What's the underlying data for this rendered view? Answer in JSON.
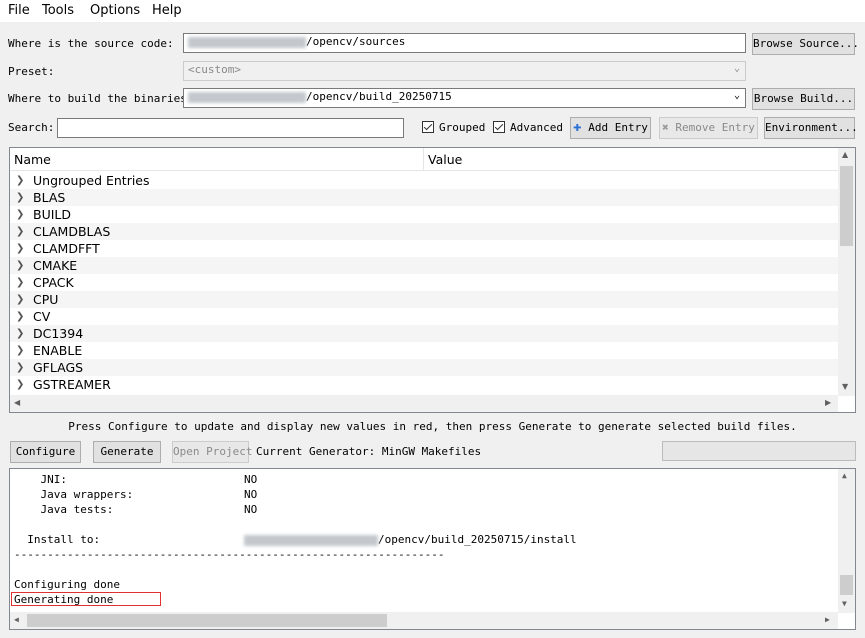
{
  "menu": [
    "File",
    "Tools",
    "Options",
    "Help"
  ],
  "source": {
    "label": "Where is the source code:",
    "value_suffix": "/opencv/sources",
    "browse_label": "Browse Source..."
  },
  "preset": {
    "label": "Preset:",
    "value": "<custom>"
  },
  "binaries": {
    "label": "Where to build the binaries:",
    "value_suffix": "/opencv/build_20250715",
    "browse_label": "Browse Build..."
  },
  "search": {
    "label": "Search:",
    "value": ""
  },
  "options": {
    "grouped_label": "Grouped",
    "grouped_checked": true,
    "advanced_label": "Advanced",
    "advanced_checked": true,
    "add_entry_label": "Add Entry",
    "remove_entry_label": "Remove Entry",
    "environment_label": "Environment..."
  },
  "table": {
    "col_name": "Name",
    "col_value": "Value",
    "rows": [
      "Ungrouped Entries",
      "BLAS",
      "BUILD",
      "CLAMDBLAS",
      "CLAMDFFT",
      "CMAKE",
      "CPACK",
      "CPU",
      "CV",
      "DC1394",
      "ENABLE",
      "GFLAGS",
      "GSTREAMER"
    ]
  },
  "hint": "Press Configure to update and display new values in red, then press Generate to generate selected build files.",
  "actions": {
    "configure_label": "Configure",
    "generate_label": "Generate",
    "open_project_label": "Open Project",
    "generator_text": "Current Generator: MinGW Makefiles"
  },
  "output": {
    "line1_key": "    JNI:",
    "line1_val": "NO",
    "line2_key": "    Java wrappers:",
    "line2_val": "NO",
    "line3_key": "    Java tests:",
    "line3_val": "NO",
    "install_key": "  Install to:",
    "install_suffix": "/opencv/build_20250715/install",
    "separator": "-----------------------------------------------------------------",
    "configuring_done": "Configuring done",
    "generating_done": "Generating done"
  },
  "colors": {
    "highlight_box": "#e03030",
    "add_icon": "#2a6fd6",
    "remove_icon": "#9a9a9a"
  }
}
